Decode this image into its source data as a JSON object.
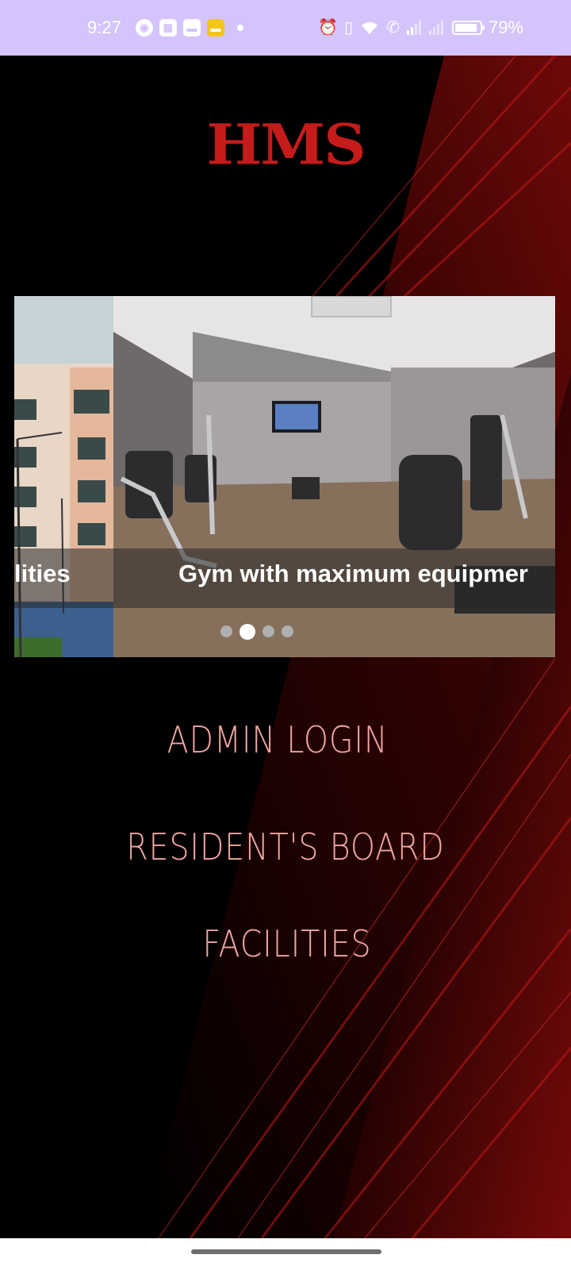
{
  "status_bar": {
    "time": "9:27",
    "battery_text": "79%",
    "battery_level": 0.79,
    "notification_icons": [
      "guard-icon",
      "gallery-icon",
      "mail-icon",
      "yellow-app-icon"
    ],
    "system_icons": [
      "alarm-icon",
      "vibrate-icon",
      "wifi-icon",
      "wifi-call-icon",
      "signal-icon",
      "signal-x-icon",
      "battery-icon"
    ]
  },
  "app": {
    "logo_text": "HMS",
    "logo_color": "#c51b1b"
  },
  "carousel": {
    "prev_caption": "lities",
    "caption": "Gym with maximum equipmer",
    "slide_count": 4,
    "active_index": 1
  },
  "menu": {
    "items": [
      "ADMIN LOGIN",
      "RESIDENT'S BOARD",
      "FACILITIES"
    ],
    "text_color": "#f0a6a2"
  }
}
